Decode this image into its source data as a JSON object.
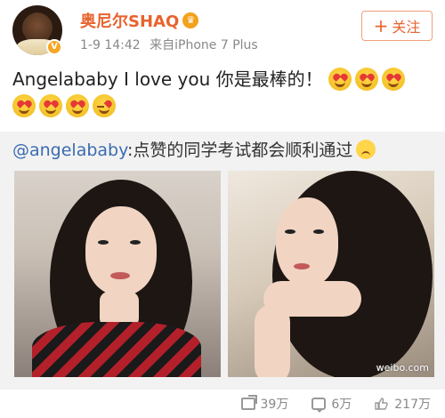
{
  "post": {
    "user": {
      "name": "奥尼尔SHAQ",
      "verified_badge": "V",
      "crown_icon": "crown-icon"
    },
    "meta": {
      "time": "1-9 14:42",
      "source": "来自iPhone 7 Plus"
    },
    "follow_button": {
      "plus": "+",
      "label": "关注"
    },
    "text": "Angelababy I love you 你是最棒的！",
    "emojis": [
      "heart-eyes",
      "heart-eyes",
      "heart-eyes",
      "heart-eyes",
      "heart-eyes",
      "heart-eyes",
      "kiss-wink"
    ],
    "repost": {
      "mention": "@angelababy",
      "text": ":点赞的同学考试都会顺利通过",
      "emoji": "frown-icon",
      "photos": [
        {
          "name": "selfie-photo-1"
        },
        {
          "name": "selfie-photo-2",
          "watermark": "weibo.com"
        }
      ]
    },
    "actions": {
      "repost_count": "39万",
      "comment_count": "6万",
      "like_count": "217万"
    }
  },
  "colors": {
    "username": "#e8632f",
    "mention": "#3a6cb0",
    "meta": "#888888",
    "repost_bg": "#f2f2f2"
  }
}
